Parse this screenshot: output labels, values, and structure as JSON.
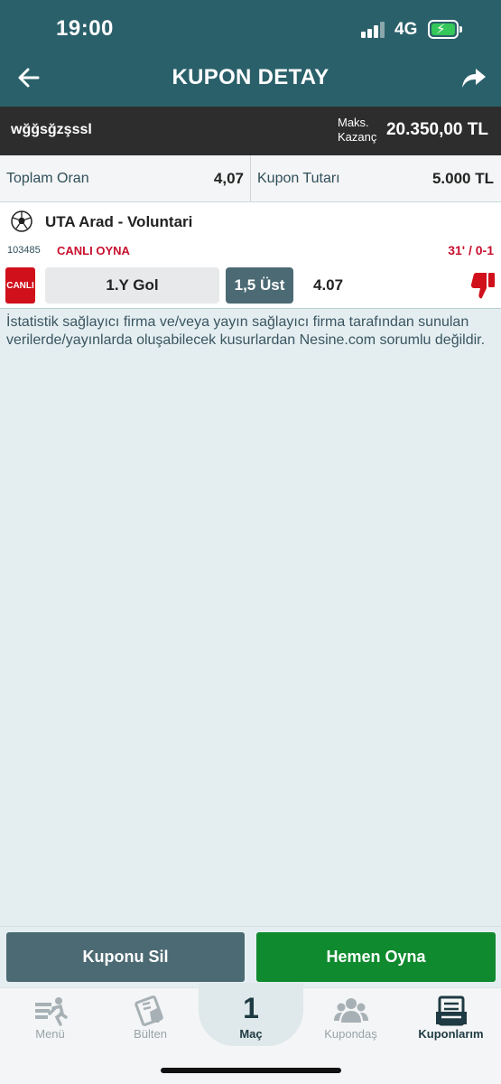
{
  "status_bar": {
    "time": "19:00",
    "network": "4G",
    "battery_percent": 100
  },
  "header": {
    "title": "KUPON DETAY",
    "back_icon": "arrow-left-icon",
    "share_icon": "share-arrow-icon"
  },
  "coupon": {
    "name": "wğğsğzşssl",
    "max_label": "Maks.\nKazanç",
    "max_value": "20.350,00 TL",
    "total_odds_label": "Toplam Oran",
    "total_odds_value": "4,07",
    "amount_label": "Kupon Tutarı",
    "amount_value": "5.000 TL"
  },
  "match": {
    "name": "UTA Arad - Voluntari",
    "code": "103485",
    "live_text": "CANLI OYNA",
    "score": "31' / 0-1",
    "badge": "CANLI",
    "market": "1.Y Gol",
    "selection": "1,5 Üst",
    "odd": "4.07",
    "result_icon": "thumbs-down-icon"
  },
  "disclaimer": "İstatistik sağlayıcı firma ve/veya yayın sağlayıcı firma tarafından sunulan verilerde/yayınlarda oluşabilecek kusurlardan Nesine.com sorumlu değildir.",
  "actions": {
    "delete_label": "Kuponu Sil",
    "play_label": "Hemen Oyna"
  },
  "tabs": [
    {
      "label": "Menü",
      "icon": "menu-runner-icon"
    },
    {
      "label": "Bülten",
      "icon": "bulletin-hand-icon"
    },
    {
      "label": "Maç",
      "count": "1"
    },
    {
      "label": "Kupondaş",
      "icon": "users-group-icon"
    },
    {
      "label": "Kuponlarım",
      "icon": "coupons-icon"
    }
  ],
  "colors": {
    "header": "#2a6069",
    "live_red": "#c8102e",
    "play_green": "#0f8a2e",
    "delete_slate": "#4c6a73"
  }
}
